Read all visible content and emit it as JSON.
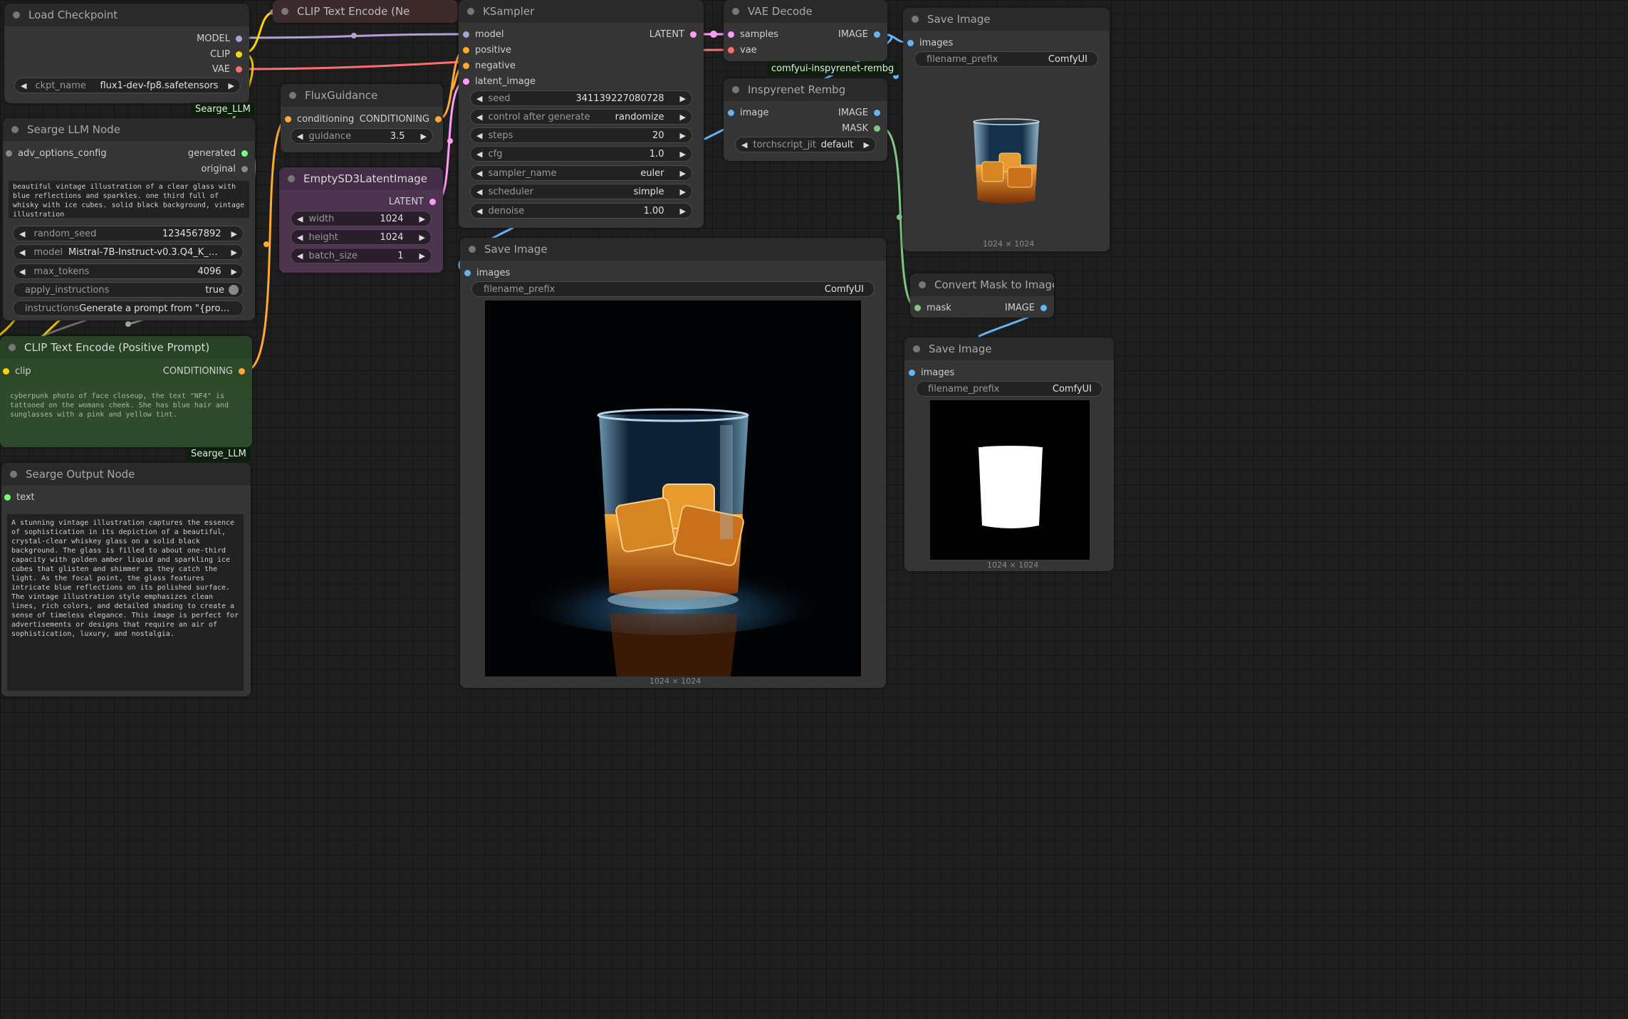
{
  "colors": {
    "model": "#b39ddb",
    "clip": "#ffd500",
    "vae": "#ff6e6e",
    "conditioning": "#ffa931",
    "latent": "#ff9cf9",
    "image": "#64b5f6",
    "mask": "#81c784",
    "string": "#77ff77",
    "config": "#888888"
  },
  "load_checkpoint": {
    "title": "Load Checkpoint",
    "outputs": [
      "MODEL",
      "CLIP",
      "VAE"
    ],
    "ckpt_label": "ckpt_name",
    "ckpt_value": "flux1-dev-fp8.safetensors"
  },
  "seg_llm": {
    "badge": "Searge_LLM",
    "title": "Searge LLM Node",
    "input": "adv_options_config",
    "outputs": [
      "generated",
      "original"
    ],
    "text": "beautiful vintage illustration of a clear glass with blue reflections and sparkles. one third full of whisky with ice cubes. solid black background, vintage illustration",
    "random_seed_label": "random_seed",
    "random_seed_value": "1234567892",
    "model_label": "model",
    "model_value": "Mistral-7B-Instruct-v0.3.Q4_K_M.g...",
    "max_tokens_label": "max_tokens",
    "max_tokens_value": "4096",
    "apply_label": "apply_instructions",
    "apply_value": "true",
    "instructions_label": "instructions",
    "instructions_value": "Generate a prompt from \"{promp"
  },
  "clip_pos": {
    "title": "CLIP Text Encode (Positive Prompt)",
    "input": "clip",
    "output": "CONDITIONING",
    "text": "cyberpunk photo of face closeup, the text \"NF4\" is tattooed on the womans cheek. She has blue hair and sunglasses with a pink and yellow tint.",
    "badge": "Searge_LLM"
  },
  "seg_output": {
    "title": "Searge Output Node",
    "input": "text",
    "text": "A stunning vintage illustration captures the essence of sophistication in its depiction of a beautiful, crystal-clear whiskey glass on a solid black background. The glass is filled to about one-third capacity with golden amber liquid and sparkling ice cubes that glisten and shimmer as they catch the light. As the focal point, the glass features intricate blue reflections on its polished surface. The vintage illustration style emphasizes clean lines, rich colors, and detailed shading to create a sense of timeless elegance. This image is perfect for advertisements or designs that require an air of sophistication, luxury, and nostalgia."
  },
  "clip_neg": {
    "title": "CLIP Text Encode (Ne"
  },
  "flux_guidance": {
    "title": "FluxGuidance",
    "input": "conditioning",
    "output": "CONDITIONING",
    "guidance_label": "guidance",
    "guidance_value": "3.5"
  },
  "empty_latent": {
    "title": "EmptySD3LatentImage",
    "output": "LATENT",
    "width_label": "width",
    "width_value": "1024",
    "height_label": "height",
    "height_value": "1024",
    "batch_label": "batch_size",
    "batch_value": "1"
  },
  "ksampler": {
    "title": "KSampler",
    "inputs": [
      "model",
      "positive",
      "negative",
      "latent_image"
    ],
    "output": "LATENT",
    "widgets": [
      {
        "label": "seed",
        "value": "341139227080728"
      },
      {
        "label": "control after generate",
        "value": "randomize"
      },
      {
        "label": "steps",
        "value": "20"
      },
      {
        "label": "cfg",
        "value": "1.0"
      },
      {
        "label": "sampler_name",
        "value": "euler"
      },
      {
        "label": "scheduler",
        "value": "simple"
      },
      {
        "label": "denoise",
        "value": "1.00"
      }
    ]
  },
  "vae_decode": {
    "title": "VAE Decode",
    "inputs": [
      "samples",
      "vae"
    ],
    "output": "IMAGE",
    "badge": "comfyui-inspyrenet-rembg"
  },
  "inspyrenet": {
    "title": "Inspyrenet Rembg",
    "input": "image",
    "outputs": [
      "IMAGE",
      "MASK"
    ],
    "jit_label": "torchscript_jit",
    "jit_value": "default"
  },
  "save_main": {
    "title": "Save Image",
    "input": "images",
    "prefix_label": "filename_prefix",
    "prefix_value": "ComfyUI",
    "caption": "1024 × 1024"
  },
  "save_top": {
    "title": "Save Image",
    "input": "images",
    "prefix_label": "filename_prefix",
    "prefix_value": "ComfyUI",
    "caption": "1024 × 1024"
  },
  "convert_mask": {
    "title": "Convert Mask to Image",
    "input": "mask",
    "output": "IMAGE"
  },
  "save_mask": {
    "title": "Save Image",
    "input": "images",
    "prefix_label": "filename_prefix",
    "prefix_value": "ComfyUI",
    "caption": "1024 × 1024"
  }
}
